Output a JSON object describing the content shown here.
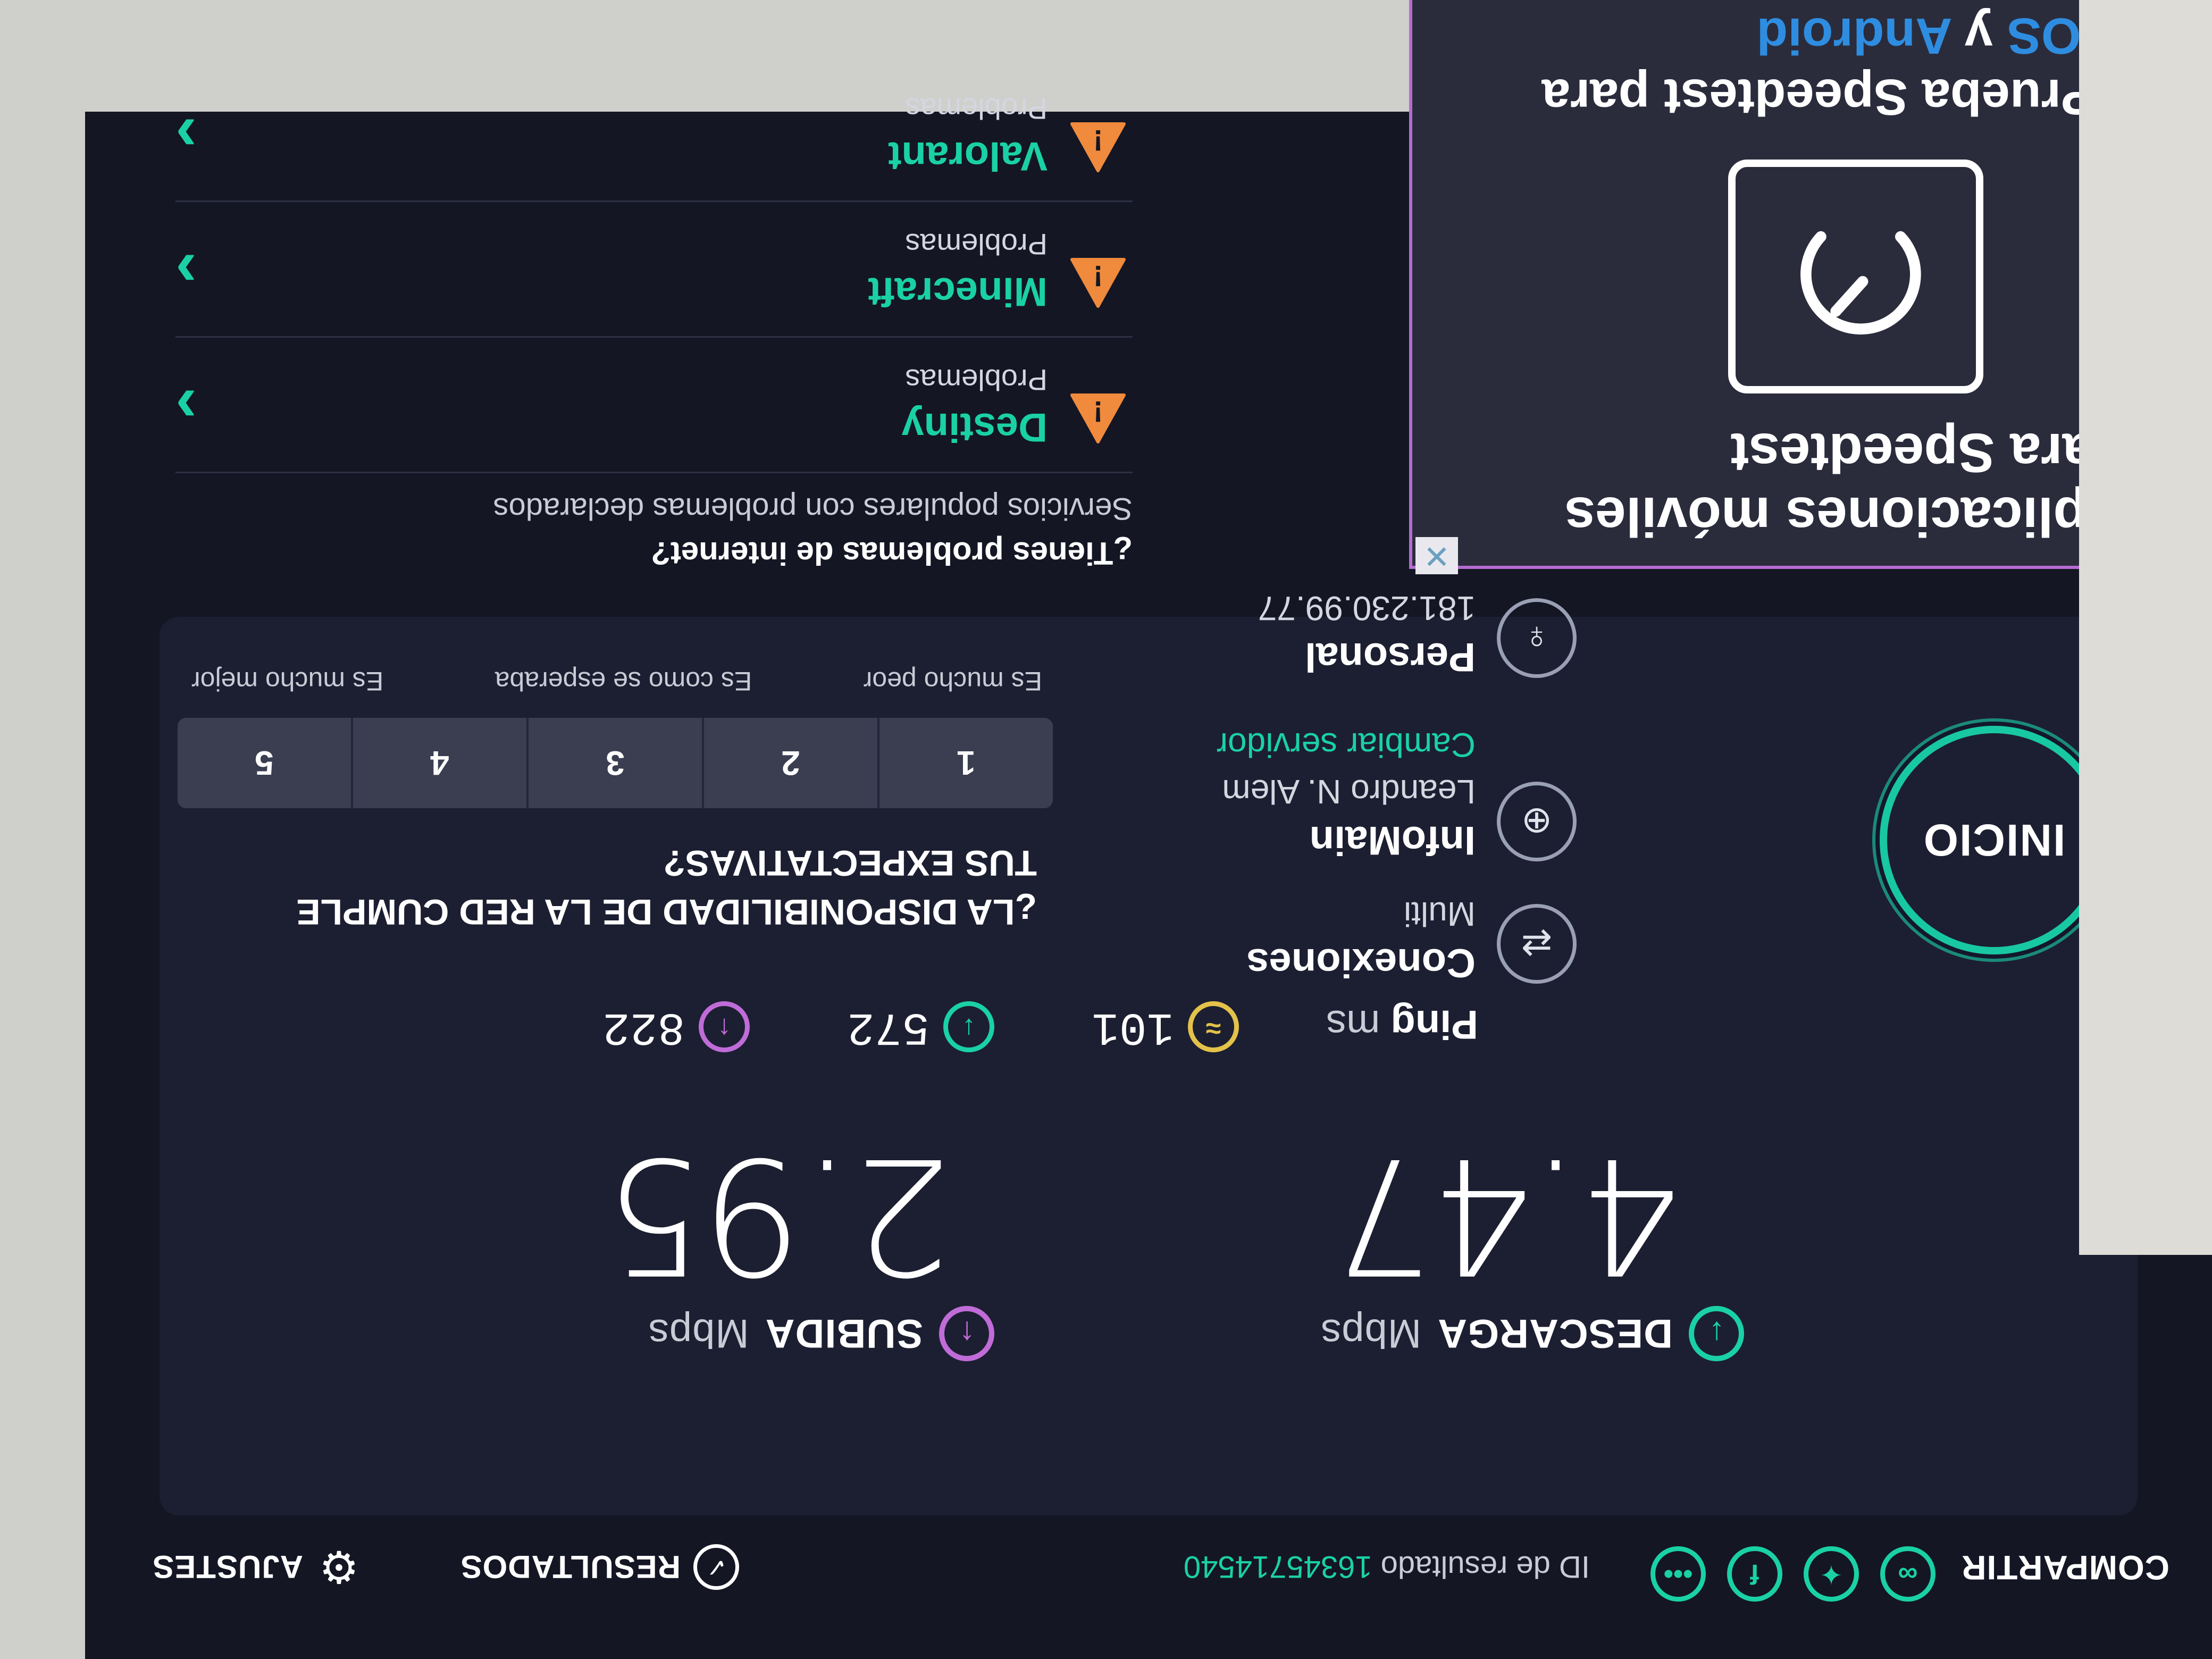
{
  "header": {
    "share_label": "COMPARTIR",
    "result_id_label": "ID de resultado",
    "result_id_value": "16345714540",
    "results_label": "RESULTADOS",
    "settings_label": "AJUSTES"
  },
  "download": {
    "label": "DESCARGA",
    "unit": "Mbps",
    "value": "4.47"
  },
  "upload": {
    "label": "SUBIDA",
    "unit": "Mbps",
    "value": "2.95"
  },
  "ping": {
    "label": "Ping",
    "unit": "ms",
    "idle": "101",
    "download": "822",
    "upload": "572"
  },
  "connection": {
    "connections_label": "Conexiones",
    "connections_value": "Multi",
    "server_name": "InfoMain",
    "server_location": "Leandro N. Alem",
    "change_server": "Cambiar servidor",
    "isp_name": "Personal",
    "ip": "181.230.99.77"
  },
  "go_button": "INICIO",
  "survey": {
    "question": "¿LA DISPONIBILIDAD DE LA RED CUMPLE TUS EXPECTATIVAS?",
    "options": [
      "1",
      "2",
      "3",
      "4",
      "5"
    ],
    "low_label": "Es mucho peor",
    "mid_label": "Es como se esperaba",
    "high_label": "Es mucho mejor"
  },
  "problems": {
    "title": "¿Tienes problemas de internet?",
    "subtitle": "Servicios populares con problemas declarados",
    "services": [
      {
        "name": "Destiny",
        "status": "Problemas"
      },
      {
        "name": "Minecraft",
        "status": "Problemas"
      },
      {
        "name": "Valorant",
        "status": "Problemas"
      }
    ]
  },
  "ad": {
    "title": "Aplicaciones móviles para Speedtest",
    "sub_prefix": "Prueba Speedtest para",
    "sub_ios": "iOS",
    "sub_and": "y",
    "sub_android": "Android"
  },
  "colors": {
    "accent": "#1ad1a5",
    "download": "#1ad1a5",
    "upload": "#c06cd8",
    "ping_idle": "#e3c24a",
    "warning": "#f08a3c",
    "background": "#141624"
  }
}
